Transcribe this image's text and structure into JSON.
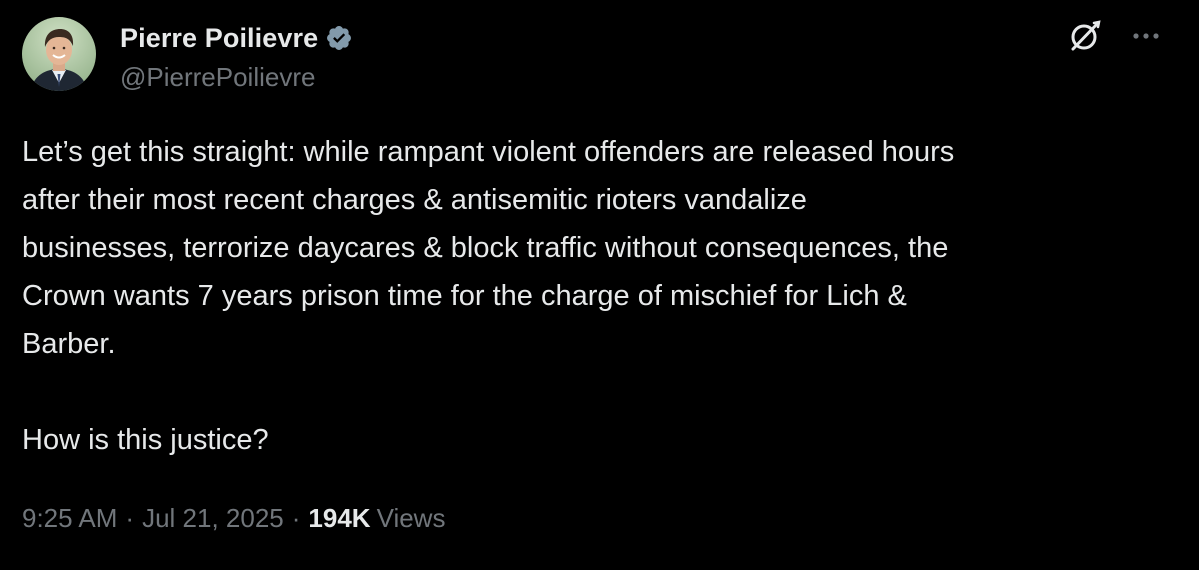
{
  "author": {
    "display_name": "Pierre Poilievre",
    "handle": "@PierrePoilievre",
    "verified": true,
    "avatar": "profile-photo"
  },
  "icons": {
    "verified": "verified-badge-icon",
    "grok": "grok-icon",
    "more": "more-options-icon"
  },
  "colors": {
    "background": "#000000",
    "text_primary": "#e7e9ea",
    "text_secondary": "#71767b",
    "verified_badge": "#829aab"
  },
  "tweet": {
    "text": "Let’s get this straight: while rampant violent offenders are released hours\nafter their most recent charges & antisemitic rioters vandalize\nbusinesses, terrorize daycares & block traffic without consequences, the\nCrown wants 7 years prison time for the charge of mischief for Lich &\nBarber.\n\nHow is this justice?"
  },
  "meta": {
    "time": "9:25 AM",
    "date": "Jul 21, 2025",
    "separator": "·",
    "views_count": "194K",
    "views_label": "Views"
  }
}
